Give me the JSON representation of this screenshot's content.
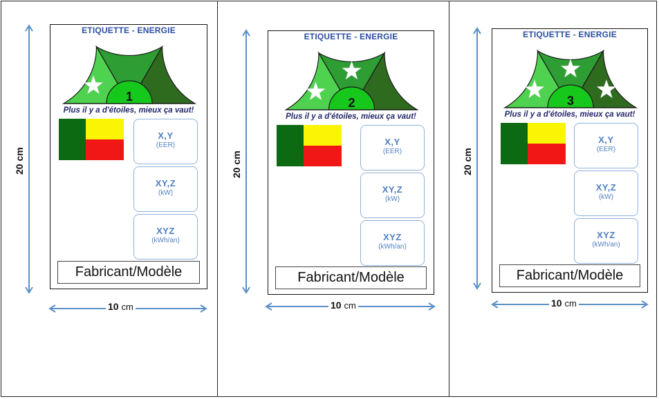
{
  "labels": [
    {
      "title": "ETIQUETTE - ENERGIE",
      "stars": 1,
      "class_number": "1",
      "slogan": "Plus il y a d'étoiles, mieux ça vaut!",
      "boxes": [
        {
          "value": "X,Y",
          "unit": "(EER)"
        },
        {
          "value": "XY,Z",
          "unit": "(kW)"
        },
        {
          "value": "XYZ",
          "unit": "(kWh/an)"
        }
      ],
      "manufacturer": "Fabricant/Modèle",
      "height_label": "20 cm",
      "width_label_num": "10",
      "width_label_unit": "cm"
    },
    {
      "title": "ETIQUETTE - ENERGIE",
      "stars": 2,
      "class_number": "2",
      "slogan": "Plus il y a d'étoiles, mieux ça vaut!",
      "boxes": [
        {
          "value": "X,Y",
          "unit": "(EER)"
        },
        {
          "value": "XY,Z",
          "unit": "(kW)"
        },
        {
          "value": "XYZ",
          "unit": "(kWh/an)"
        }
      ],
      "manufacturer": "Fabricant/Modèle",
      "height_label": "20 cm",
      "width_label_num": "10",
      "width_label_unit": "cm"
    },
    {
      "title": "ETIQUETTE - ENERGIE",
      "stars": 3,
      "class_number": "3",
      "slogan": "Plus il y a d'étoiles, mieux ça vaut!",
      "boxes": [
        {
          "value": "X,Y",
          "unit": "(EER)"
        },
        {
          "value": "XY,Z",
          "unit": "(kW)"
        },
        {
          "value": "XYZ",
          "unit": "(kWh/an)"
        }
      ],
      "manufacturer": "Fabricant/Modèle",
      "height_label": "20 cm",
      "width_label_num": "10",
      "width_label_unit": "cm"
    }
  ],
  "colors": {
    "segment_light": "#4fd24f",
    "segment_mid": "#2e9e34",
    "segment_dark": "#2e6b1e",
    "center_disc": "#17c81c",
    "title_blue": "#2b4fa0",
    "box_blue": "#4f7fc2",
    "arrow_blue": "#5b8fc9",
    "flag_green": "#0b6a12",
    "flag_yellow": "#f9f505",
    "flag_red": "#f11717"
  },
  "icons": [
    "star-icon",
    "arrow-vertical-icon",
    "arrow-horizontal-icon"
  ]
}
